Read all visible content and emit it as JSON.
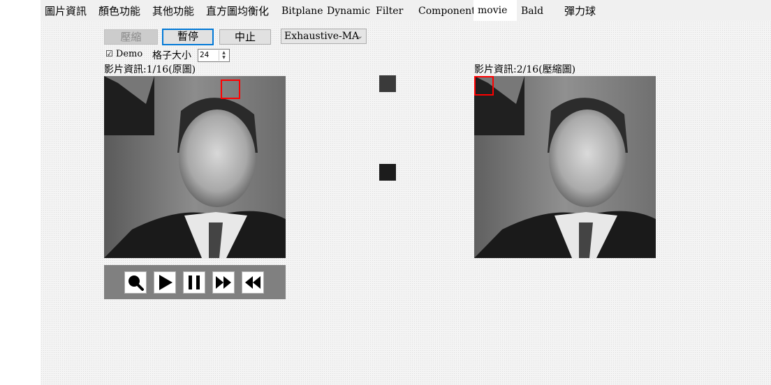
{
  "tabs": [
    {
      "label": "圖片資訊",
      "active": false
    },
    {
      "label": "顏色功能",
      "active": false
    },
    {
      "label": "其他功能",
      "active": false
    },
    {
      "label": "直方圖均衡化",
      "active": false
    },
    {
      "label": "Bitplane",
      "active": false
    },
    {
      "label": "Dynamic",
      "active": false
    },
    {
      "label": "Filter",
      "active": false
    },
    {
      "label": "Component",
      "active": false
    },
    {
      "label": "movie",
      "active": true
    },
    {
      "label": "Bald",
      "active": false
    },
    {
      "label": "彈力球",
      "active": false
    }
  ],
  "toolbar": {
    "compress_label": "壓縮",
    "pause_label": "暫停",
    "stop_label": "中止",
    "method_value": "Exhaustive-MA"
  },
  "options": {
    "demo_label": "Demo",
    "demo_checked": true,
    "grid_label": "格子大小",
    "grid_value": "24"
  },
  "left_video": {
    "caption": "影片資訊:1/16(原圖)"
  },
  "right_video": {
    "caption": "影片資訊:2/16(壓縮圖)"
  },
  "blocks": {
    "top_color": "#3a3a3a",
    "bottom_color": "#1c1c1c"
  },
  "player_controls": [
    {
      "name": "zoom-icon"
    },
    {
      "name": "play-icon"
    },
    {
      "name": "pause-icon"
    },
    {
      "name": "fast-forward-icon"
    },
    {
      "name": "rewind-icon"
    }
  ],
  "colors": {
    "highlight": "#ff0000",
    "focus_border": "#0078d7"
  }
}
